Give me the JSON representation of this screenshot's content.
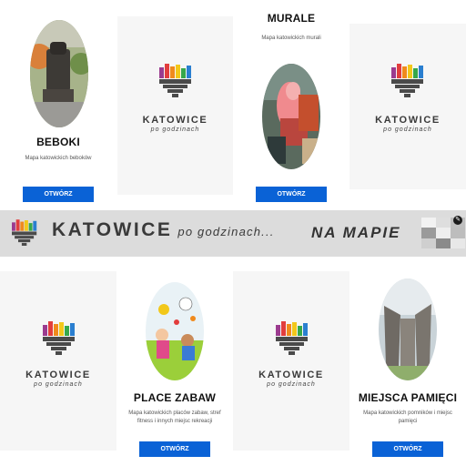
{
  "cards_top": [
    {
      "title": "BEBOKI",
      "desc": "Mapa katowickich beboków",
      "button": "OTWÓRZ"
    },
    {
      "logo_word": "KATOWICE",
      "logo_sub": "po godzinach"
    },
    {
      "title": "MURALE",
      "desc": "Mapa katowickich murali",
      "button": "OTWÓRZ"
    },
    {
      "logo_word": "KATOWICE",
      "logo_sub": "po godzinach"
    }
  ],
  "banner": {
    "brand": "KATOWICE",
    "sub": "po godzinach...",
    "right": "NA MAPIE"
  },
  "cards_bottom": [
    {
      "logo_word": "KATOWICE",
      "logo_sub": "po godzinach"
    },
    {
      "title": "PLACE ZABAW",
      "desc": "Mapa katowickich placów zabaw, stref fitness i innych miejsc rekreacji",
      "button": "OTWÓRZ"
    },
    {
      "logo_word": "KATOWICE",
      "logo_sub": "po godzinach"
    },
    {
      "title": "MIEJSCA PAMIĘCI",
      "desc": "Mapa katowickich pomników i miejsc pamięci",
      "button": "OTWÓRZ"
    }
  ],
  "colors": {
    "button": "#0a62d6",
    "logo_bars": [
      "#9b3b8f",
      "#e23d3d",
      "#f08a1c",
      "#f2c81a",
      "#37a84a",
      "#2a7fd0"
    ],
    "logo_gray": "#4a4a4a"
  }
}
